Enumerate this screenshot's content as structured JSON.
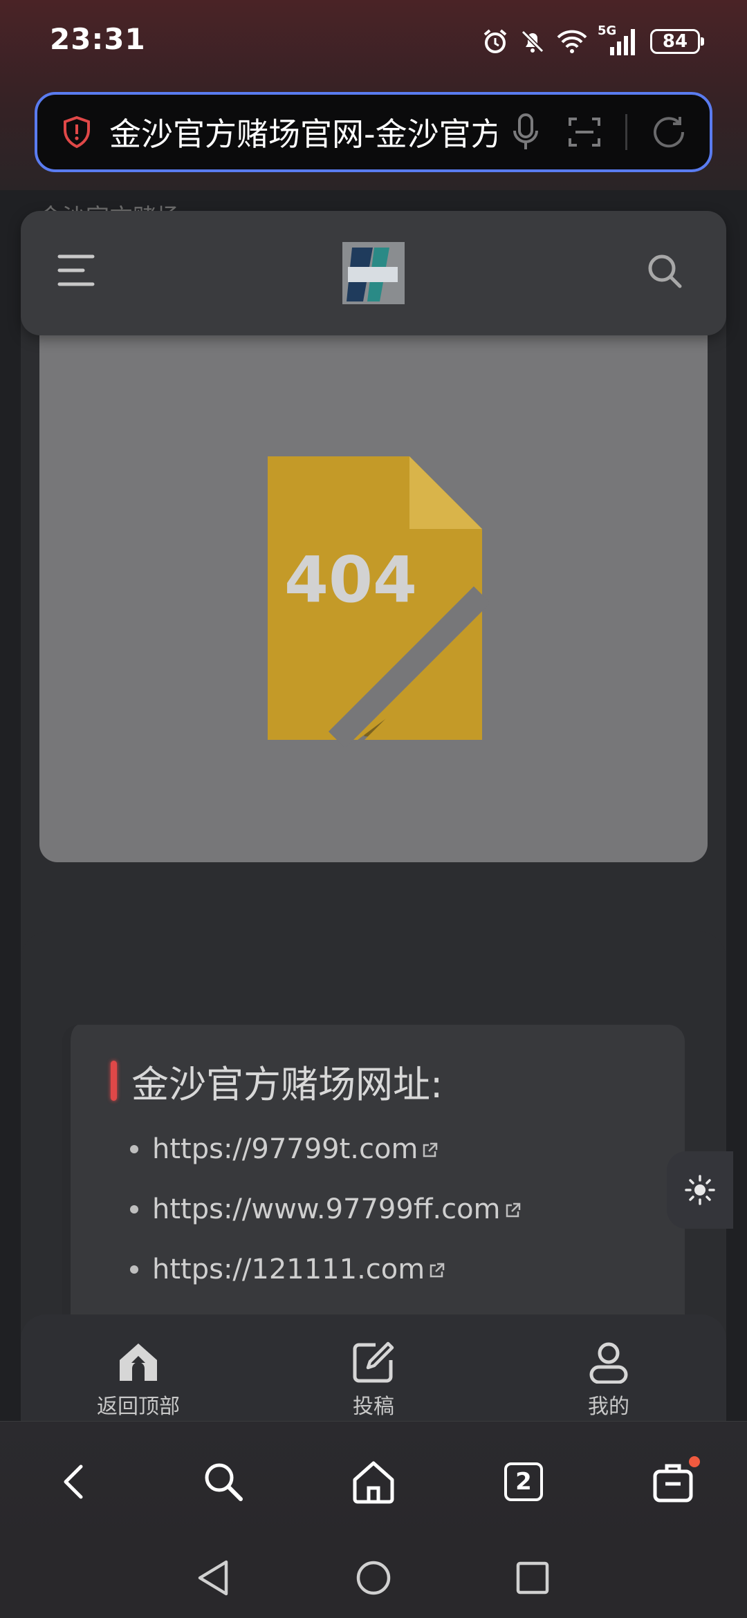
{
  "status_bar": {
    "time": "23:31",
    "network": "5G",
    "battery": "84"
  },
  "url_bar": {
    "text": "金沙官方赌场官网-金沙官方"
  },
  "page": {
    "behind_title": "金沙官方赌场",
    "header": {
      "logo_alt": "找彩8"
    },
    "image": {
      "error_code": "404"
    },
    "section": {
      "title": "金沙官方赌场网址:",
      "links": [
        "https://97799t.com",
        "https://www.97799ff.com",
        "https://121111.com"
      ]
    },
    "bottom_nav": [
      {
        "label": "返回顶部",
        "icon": "back-to-top-icon"
      },
      {
        "label": "投稿",
        "icon": "edit-icon"
      },
      {
        "label": "我的",
        "icon": "user-icon"
      }
    ]
  },
  "browser_toolbar": {
    "tabs_count": "2"
  },
  "colors": {
    "accent": "#5a7cf0",
    "highlight": "#e04848",
    "placeholder": "#c49a28"
  }
}
